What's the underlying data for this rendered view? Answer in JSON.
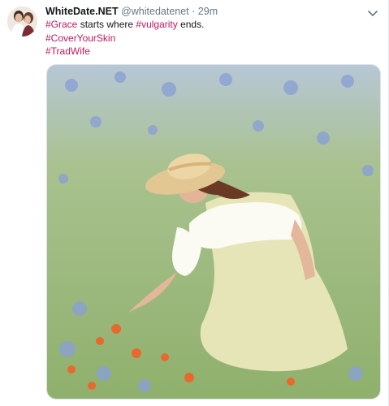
{
  "tweet": {
    "display_name": "WhiteDate.NET",
    "handle": "@whitedatenet",
    "separator": "·",
    "time": "29m",
    "lines": [
      {
        "tag1": "#Grace",
        "text1": " starts where ",
        "tag2": "#vulgarity",
        "text2": " ends."
      },
      {
        "tag": "#CoverYourSkin"
      },
      {
        "tag": "#TradWife"
      }
    ],
    "icons": {
      "avatar": "profile-photo",
      "caret": "chevron-down-icon"
    }
  },
  "colors": {
    "hashtag": "#c2185b",
    "muted": "#657786",
    "text": "#14171a"
  }
}
